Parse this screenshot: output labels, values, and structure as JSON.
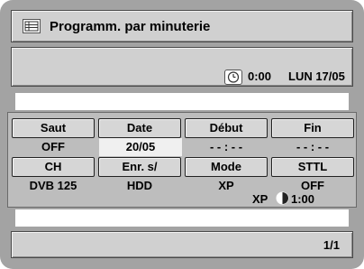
{
  "title": {
    "icon": "list-grid-icon",
    "text": "Programm. par minuterie"
  },
  "clock": {
    "icon": "clock-icon",
    "time": "0:00",
    "date": "LUN 17/05"
  },
  "timer_table": {
    "row1_headers": [
      "Saut",
      "Date",
      "Début",
      "Fin"
    ],
    "row1_values": [
      "OFF",
      "20/05",
      "- - : - -",
      "- - : - -"
    ],
    "row2_headers": [
      "CH",
      "Enr. s/",
      "Mode",
      "STTL"
    ],
    "row2_values": [
      "DVB 125",
      "HDD",
      "XP",
      "OFF"
    ],
    "selected_value": "20/05",
    "mode_line": {
      "mode": "XP",
      "progress_icon": "half-disc-icon",
      "remaining": "1:00"
    }
  },
  "footer": {
    "page": "1/1"
  },
  "colors": {
    "background": "#a3a3a3",
    "panel": "#d0d0d0",
    "header_cell": "#d6d6d6",
    "row_white": "#ffffff"
  }
}
